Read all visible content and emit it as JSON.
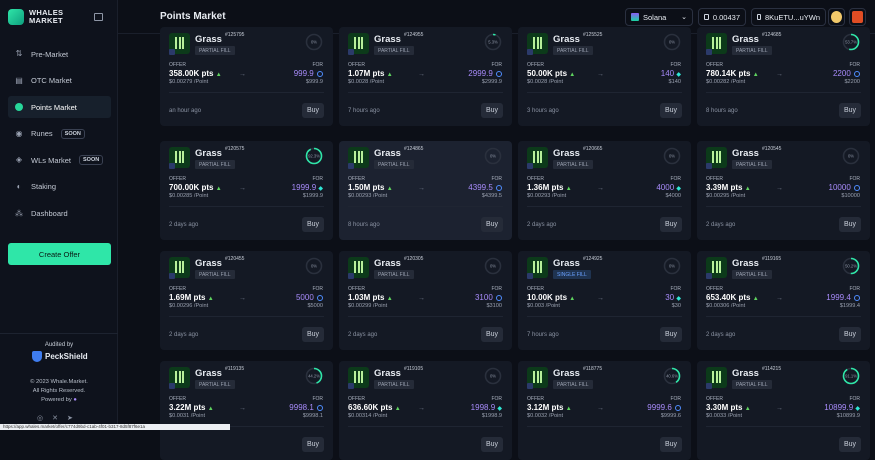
{
  "app": {
    "logo_line1": "WHALES",
    "logo_line2": "MARKET"
  },
  "sidebar": {
    "items": [
      {
        "label": "Pre-Market",
        "soon": ""
      },
      {
        "label": "OTC Market",
        "soon": ""
      },
      {
        "label": "Points Market",
        "soon": ""
      },
      {
        "label": "Runes",
        "soon": "SOON"
      },
      {
        "label": "WLs Market",
        "soon": "SOON"
      },
      {
        "label": "Staking",
        "soon": ""
      },
      {
        "label": "Dashboard",
        "soon": ""
      }
    ],
    "create_offer": "Create Offer",
    "audited_by": "Audited by",
    "auditor": "PeckShield",
    "copyright": "© 2023 Whale.Market.",
    "rights": "All Rights Reserved.",
    "powered": "Powered by"
  },
  "header": {
    "title": "Points Market",
    "chain": "Solana",
    "balance": "0.00437",
    "wallet": "8KuETU...uYWn"
  },
  "labels": {
    "offer": "OFFER",
    "for": "FOR",
    "buy": "Buy"
  },
  "status_url": "https://app.whales.market/offer/c774d9bd-c1ab-4f01-b317-8d5f87f6e1a",
  "cards": [
    {
      "name": "Grass",
      "id": "#125795",
      "fill": "PARTIAL FILL",
      "pct": "0%",
      "progress": 0,
      "offer": "358.00K pts",
      "price": "$0.00279 /Point",
      "for": "999.9",
      "usd": "$999.9",
      "cur": "coin",
      "time": "an hour ago"
    },
    {
      "name": "Grass",
      "id": "#124955",
      "fill": "PARTIAL FILL",
      "pct": "5.3%",
      "progress": 0.053,
      "offer": "1.07M pts",
      "price": "$0.0028 /Point",
      "for": "2999.9",
      "usd": "$2999.9",
      "cur": "coin",
      "time": "7 hours ago"
    },
    {
      "name": "Grass",
      "id": "#125525",
      "fill": "PARTIAL FILL",
      "pct": "0%",
      "progress": 0,
      "offer": "50.00K pts",
      "price": "$0.0028 /Point",
      "for": "140",
      "usd": "$140",
      "cur": "gem",
      "time": "3 hours ago"
    },
    {
      "name": "Grass",
      "id": "#124685",
      "fill": "PARTIAL FILL",
      "pct": "53.7%",
      "progress": 0.537,
      "offer": "780.14K pts",
      "price": "$0.00282 /Point",
      "for": "2200",
      "usd": "$2200",
      "cur": "coin",
      "time": "8 hours ago"
    },
    {
      "name": "Grass",
      "id": "#120575",
      "fill": "PARTIAL FILL",
      "pct": "92.3%",
      "progress": 0.923,
      "offer": "700.00K pts",
      "price": "$0.00285 /Point",
      "for": "1999.9",
      "usd": "$1999.9",
      "cur": "gem",
      "time": "2 days ago"
    },
    {
      "name": "Grass",
      "id": "#124865",
      "fill": "PARTIAL FILL",
      "pct": "0%",
      "progress": 0,
      "offer": "1.50M pts",
      "price": "$0.00293 /Point",
      "for": "4399.5",
      "usd": "$4399.5",
      "cur": "coin",
      "time": "8 hours ago"
    },
    {
      "name": "Grass",
      "id": "#120665",
      "fill": "PARTIAL FILL",
      "pct": "0%",
      "progress": 0,
      "offer": "1.36M pts",
      "price": "$0.00293 /Point",
      "for": "4000",
      "usd": "$4000",
      "cur": "gem",
      "time": "2 days ago"
    },
    {
      "name": "Grass",
      "id": "#120545",
      "fill": "PARTIAL FILL",
      "pct": "0%",
      "progress": 0,
      "offer": "3.39M pts",
      "price": "$0.00295 /Point",
      "for": "10000",
      "usd": "$10000",
      "cur": "coin",
      "time": "2 days ago"
    },
    {
      "name": "Grass",
      "id": "#120455",
      "fill": "PARTIAL FILL",
      "pct": "0%",
      "progress": 0,
      "offer": "1.69M pts",
      "price": "$0.00296 /Point",
      "for": "5000",
      "usd": "$5000",
      "cur": "coin",
      "time": "2 days ago"
    },
    {
      "name": "Grass",
      "id": "#120305",
      "fill": "PARTIAL FILL",
      "pct": "0%",
      "progress": 0,
      "offer": "1.03M pts",
      "price": "$0.00299 /Point",
      "for": "3100",
      "usd": "$3100",
      "cur": "coin",
      "time": "2 days ago"
    },
    {
      "name": "Grass",
      "id": "#124925",
      "fill": "SINGLE FILL",
      "pct": "0%",
      "progress": 0,
      "offer": "10.00K pts",
      "price": "$0.003 /Point",
      "for": "30",
      "usd": "$30",
      "cur": "gem",
      "time": "7 hours ago"
    },
    {
      "name": "Grass",
      "id": "#119165",
      "fill": "PARTIAL FILL",
      "pct": "50.2%",
      "progress": 0.502,
      "offer": "653.40K pts",
      "price": "$0.00306 /Point",
      "for": "1999.4",
      "usd": "$1999.4",
      "cur": "coin",
      "time": "2 days ago"
    },
    {
      "name": "Grass",
      "id": "#119135",
      "fill": "PARTIAL FILL",
      "pct": "44.2%",
      "progress": 0.442,
      "offer": "3.22M pts",
      "price": "$0.0031 /Point",
      "for": "9998.1",
      "usd": "$9998.1",
      "cur": "coin",
      "time": ""
    },
    {
      "name": "Grass",
      "id": "#119105",
      "fill": "PARTIAL FILL",
      "pct": "0%",
      "progress": 0,
      "offer": "636.60K pts",
      "price": "$0.00314 /Point",
      "for": "1998.9",
      "usd": "$1998.9",
      "cur": "gem",
      "time": ""
    },
    {
      "name": "Grass",
      "id": "#118775",
      "fill": "PARTIAL FILL",
      "pct": "40.6%",
      "progress": 0.406,
      "offer": "3.12M pts",
      "price": "$0.0032 /Point",
      "for": "9999.6",
      "usd": "$9999.6",
      "cur": "coin",
      "time": ""
    },
    {
      "name": "Grass",
      "id": "#114215",
      "fill": "PARTIAL FILL",
      "pct": "91.1%",
      "progress": 0.911,
      "offer": "3.30M pts",
      "price": "$0.0033 /Point",
      "for": "10899.9",
      "usd": "$10899.9",
      "cur": "gem",
      "time": ""
    }
  ]
}
